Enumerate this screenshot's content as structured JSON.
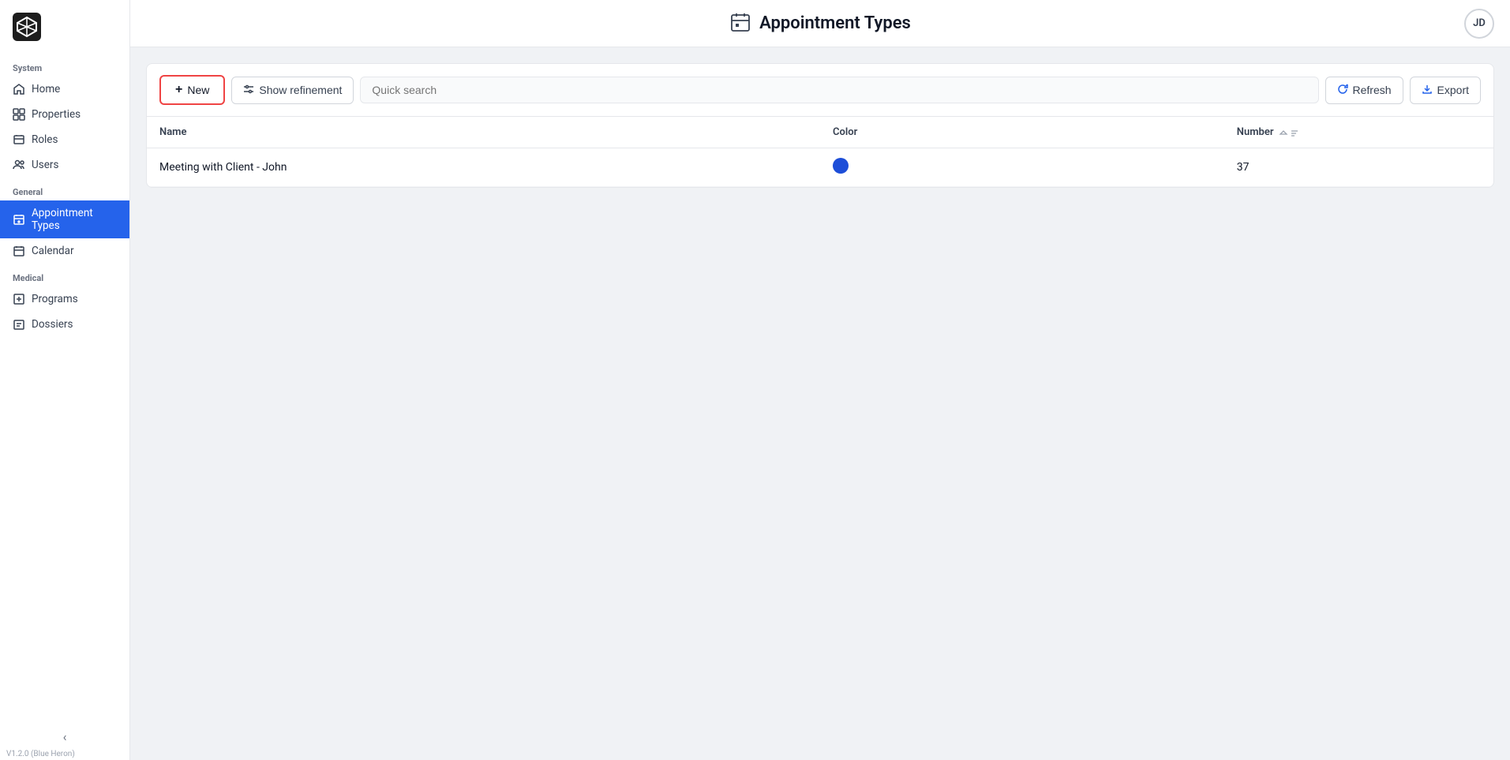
{
  "sidebar": {
    "logo_alt": "App Logo",
    "sections": [
      {
        "label": "System",
        "items": [
          {
            "id": "home",
            "label": "Home",
            "icon": "home",
            "active": false
          },
          {
            "id": "properties",
            "label": "Properties",
            "icon": "properties",
            "active": false
          },
          {
            "id": "roles",
            "label": "Roles",
            "icon": "roles",
            "active": false
          },
          {
            "id": "users",
            "label": "Users",
            "icon": "users",
            "active": false
          }
        ]
      },
      {
        "label": "General",
        "items": [
          {
            "id": "appointment-types",
            "label": "Appointment Types",
            "icon": "appointment-types",
            "active": true
          },
          {
            "id": "calendar",
            "label": "Calendar",
            "icon": "calendar",
            "active": false
          }
        ]
      },
      {
        "label": "Medical",
        "items": [
          {
            "id": "programs",
            "label": "Programs",
            "icon": "programs",
            "active": false
          },
          {
            "id": "dossiers",
            "label": "Dossiers",
            "icon": "dossiers",
            "active": false
          }
        ]
      }
    ],
    "version": "V1.2.0 (Blue Heron)"
  },
  "header": {
    "title": "Appointment Types",
    "user_initials": "JD"
  },
  "toolbar": {
    "new_label": "New",
    "refinement_label": "Show refinement",
    "search_placeholder": "Quick search",
    "refresh_label": "Refresh",
    "export_label": "Export"
  },
  "table": {
    "columns": [
      {
        "id": "name",
        "label": "Name"
      },
      {
        "id": "color",
        "label": "Color"
      },
      {
        "id": "number",
        "label": "Number"
      }
    ],
    "rows": [
      {
        "name": "Meeting with Client - John",
        "color": "#1d4ed8",
        "number": "37"
      }
    ]
  }
}
